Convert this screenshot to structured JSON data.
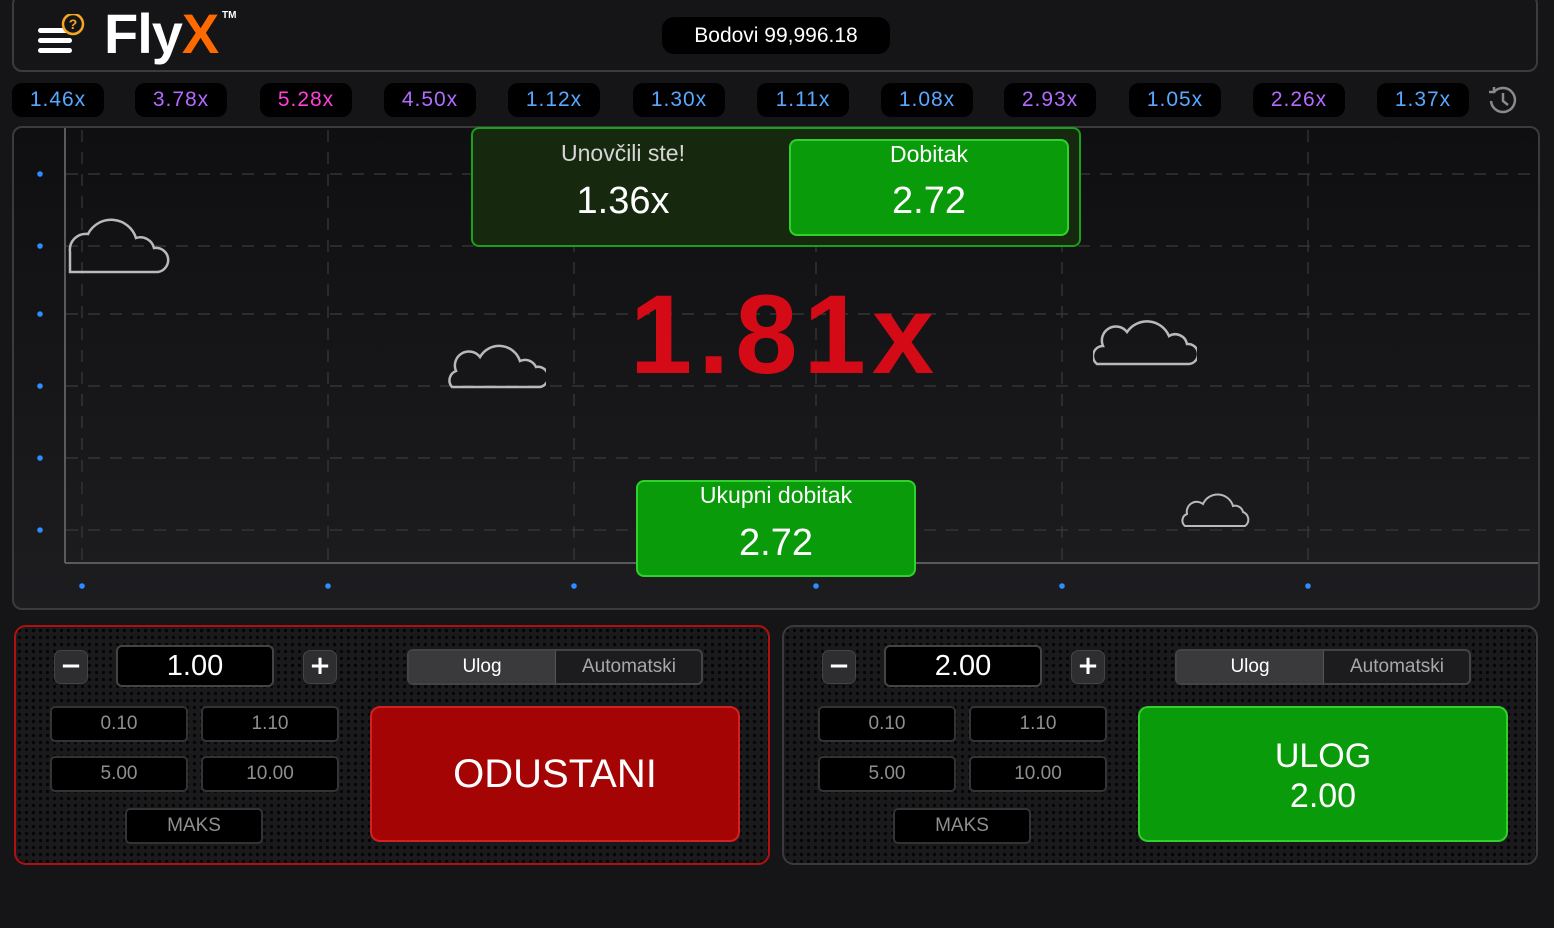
{
  "header": {
    "logo_text": "Fly",
    "logo_accent": "X",
    "logo_tm": "TM",
    "balance": "Bodovi 99,996.18"
  },
  "history": [
    {
      "value": "1.46x",
      "color": "#58a8ff"
    },
    {
      "value": "3.78x",
      "color": "#b36bff"
    },
    {
      "value": "5.28x",
      "color": "#ff3fd8"
    },
    {
      "value": "4.50x",
      "color": "#b36bff"
    },
    {
      "value": "1.12x",
      "color": "#58a8ff"
    },
    {
      "value": "1.30x",
      "color": "#58a8ff"
    },
    {
      "value": "1.11x",
      "color": "#58a8ff"
    },
    {
      "value": "1.08x",
      "color": "#58a8ff"
    },
    {
      "value": "2.93x",
      "color": "#b36bff"
    },
    {
      "value": "1.05x",
      "color": "#58a8ff"
    },
    {
      "value": "2.26x",
      "color": "#b36bff"
    },
    {
      "value": "1.37x",
      "color": "#58a8ff"
    }
  ],
  "game": {
    "multiplier": "1.81x",
    "cashout_label": "Unovčili ste!",
    "cashout_value": "1.36x",
    "win_label": "Dobitak",
    "win_value": "2.72",
    "total_label": "Ukupni dobitak",
    "total_value": "2.72"
  },
  "bet_left": {
    "amount": "1.00",
    "tab_bet": "Ulog",
    "tab_auto": "Automatski",
    "quick": [
      "0.10",
      "1.10",
      "5.00",
      "10.00"
    ],
    "max": "MAKS",
    "action_label": "ODUSTANI"
  },
  "bet_right": {
    "amount": "2.00",
    "tab_bet": "Ulog",
    "tab_auto": "Automatski",
    "quick": [
      "0.10",
      "1.10",
      "5.00",
      "10.00"
    ],
    "max": "MAKS",
    "action_label": "ULOG",
    "action_amount": "2.00"
  },
  "colors": {
    "accent_orange": "#ff6a00",
    "multiplier_red": "#d40b16",
    "win_green": "#0a9b0a",
    "cancel_red": "#a50404"
  }
}
